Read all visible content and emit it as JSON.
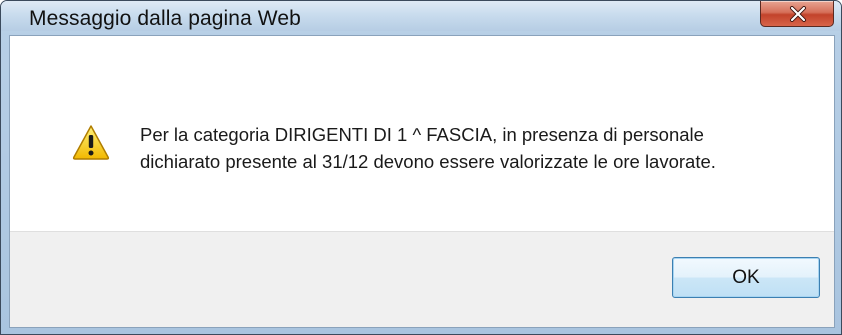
{
  "dialog": {
    "title": "Messaggio dalla pagina Web",
    "close_icon": "close-icon",
    "message_line1": "Per la categoria DIRIGENTI DI 1 ^ FASCIA, in presenza di personale",
    "message_line2": "dichiarato presente al 31/12 devono essere valorizzate le ore lavorate.",
    "icon": "warning-icon",
    "ok_label": "OK"
  },
  "colors": {
    "close_button": "#c9503a",
    "ok_button_border": "#3c7fb1",
    "button_area": "#f0f0f0",
    "warning_yellow": "#f5c400"
  }
}
